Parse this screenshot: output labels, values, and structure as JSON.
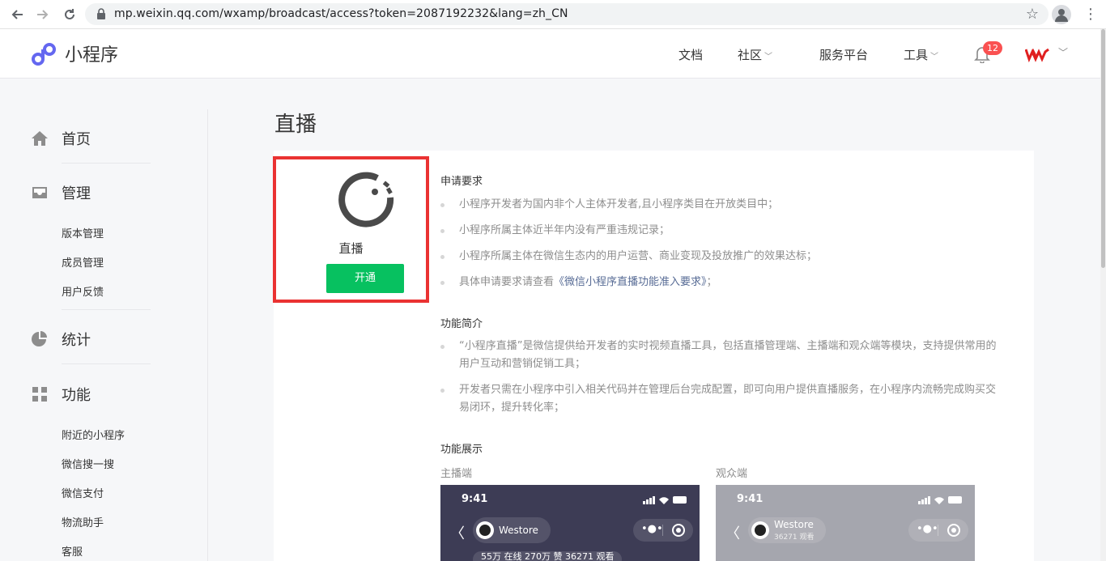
{
  "browser": {
    "url": "mp.weixin.qq.com/wxamp/broadcast/access?token=2087192232&lang=zh_CN"
  },
  "header": {
    "logo_text": "小程序",
    "nav": [
      "文档",
      "社区",
      "服务平台",
      "工具"
    ],
    "notification_count": "12"
  },
  "sidebar": {
    "sections": [
      {
        "label": "首页",
        "icon": "home-icon"
      },
      {
        "label": "管理",
        "icon": "inbox-icon",
        "items": [
          "版本管理",
          "成员管理",
          "用户反馈"
        ]
      },
      {
        "label": "统计",
        "icon": "pie-chart-icon"
      },
      {
        "label": "功能",
        "icon": "grid-icon",
        "items": [
          "附近的小程序",
          "微信搜一搜",
          "微信支付",
          "物流助手",
          "客服"
        ]
      }
    ]
  },
  "main": {
    "title": "直播",
    "feature": {
      "name": "直播",
      "button": "开通"
    },
    "requirements": {
      "title": "申请要求",
      "items": [
        "小程序开发者为国内非个人主体开发者,且小程序类目在开放类目中；",
        "小程序所属主体近半年内没有严重违规记录；",
        "小程序所属主体在微信生态内的用户运营、商业变现及投放推广的效果达标；"
      ],
      "last_prefix": "具体申请要求请查看",
      "last_link": "《微信小程序直播功能准入要求》",
      "last_suffix": "；"
    },
    "intro": {
      "title": "功能简介",
      "items": [
        "“小程序直播”是微信提供给开发者的实时视频直播工具，包括直播管理端、主播端和观众端等模块，支持提供常用的用户互动和营销促销工具；",
        "开发者只需在小程序中引入相关代码并在管理后台完成配置，即可向用户提供直播服务，在小程序内流畅完成购买交易闭环，提升转化率；"
      ]
    },
    "showcase": {
      "title": "功能展示",
      "anchor_label": "主播端",
      "audience_label": "观众端",
      "anchor_phone": {
        "time": "9:41",
        "store": "Westore",
        "stats": "55万 在线  270万 赞  36271 观看"
      },
      "audience_phone": {
        "time": "9:41",
        "store": "Westore",
        "sub": "36271 观看"
      }
    }
  },
  "colors": {
    "primary_green": "#07c160",
    "highlight_red": "#ea3232",
    "link_blue": "#576b95"
  }
}
